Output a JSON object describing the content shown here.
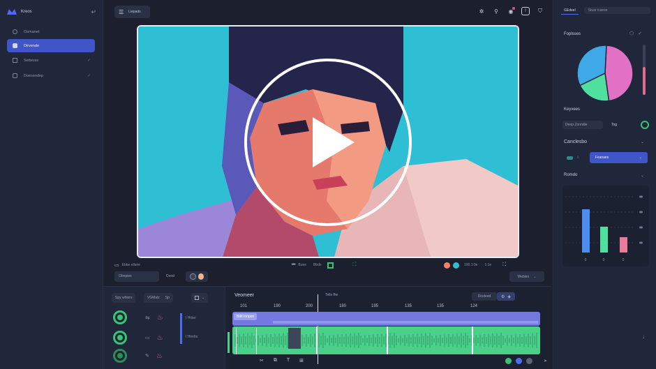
{
  "app": {
    "brand": "Kreos"
  },
  "sidebar": {
    "items": [
      {
        "label": "Osmanet",
        "active": false,
        "chevron": false
      },
      {
        "label": "Dirvende",
        "active": true,
        "chevron": false
      },
      {
        "label": "Settesse",
        "active": false,
        "chevron": true
      },
      {
        "label": "Doesendep",
        "active": false,
        "chevron": true
      }
    ]
  },
  "toolbar": {
    "tool_button": "Liepads"
  },
  "video_controls": {
    "left_text": "Ebbe ellane",
    "center_a": "Buee",
    "center_b": "Bbds",
    "time": "100 1:0e",
    "right_small": "1:1e"
  },
  "sub_controls": {
    "label_a": "Obnpies",
    "label_b": "Dood",
    "right_label": "Weblen"
  },
  "bottom_left": {
    "btn_a": "Spy whiers",
    "btn_b": "VGMalz",
    "btn_c": "Sp",
    "track_a": "I Hitiar",
    "track_b": "I Hirebs"
  },
  "timeline": {
    "title": "Veomeer",
    "marker": "Tells fhe",
    "ticks": [
      "101",
      "190",
      "200",
      "180",
      "195",
      "135",
      "135",
      "124"
    ],
    "search": "Dosteed",
    "clip_label": "Bdit Ionpon"
  },
  "right_panel": {
    "tab_active": "GEdeel",
    "tab_other": "Stuar icaese",
    "section_chart": "Foplsses",
    "section_keywords": "Keyvees",
    "keyword_input": "Deep Zonndle",
    "keyword_tag": "Tog",
    "section_crop": "Canclesbo",
    "crop_value": "Feanaes",
    "section_bars": "Romdo",
    "bar_labels": [
      "0",
      "0",
      "0"
    ]
  },
  "colors": {
    "accent": "#4056c8",
    "green": "#39c27a",
    "pink": "#e071c5",
    "cyan": "#2fbfd5"
  },
  "chart_data": {
    "type": "pie",
    "slices": [
      {
        "label": "pink",
        "value": 0.47
      },
      {
        "label": "green",
        "value": 0.2
      },
      {
        "label": "blue",
        "value": 0.33
      }
    ]
  },
  "bars_data": {
    "type": "bar",
    "values": [
      62,
      37,
      22
    ]
  }
}
